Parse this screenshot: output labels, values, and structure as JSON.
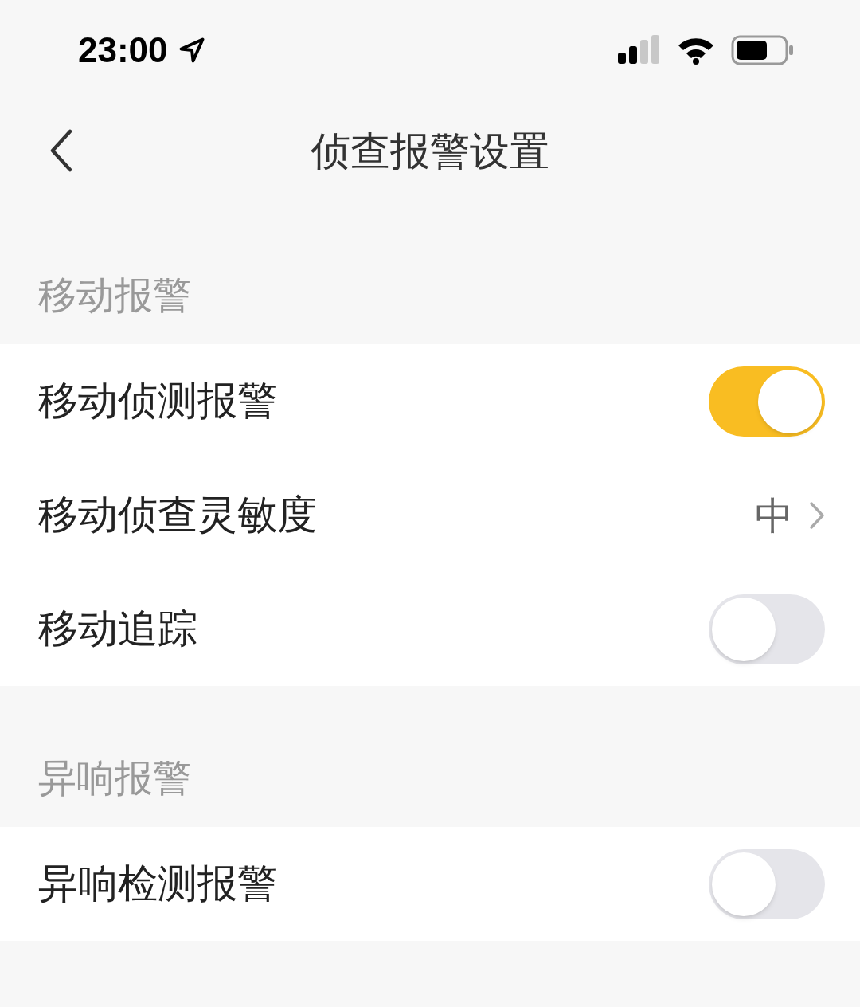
{
  "status_bar": {
    "time": "23:00"
  },
  "nav": {
    "title": "侦查报警设置"
  },
  "sections": [
    {
      "title": "移动报警",
      "rows": [
        {
          "kind": "toggle",
          "label": "移动侦测报警",
          "on": true
        },
        {
          "kind": "value",
          "label": "移动侦查灵敏度",
          "value": "中"
        },
        {
          "kind": "toggle",
          "label": "移动追踪",
          "on": false
        }
      ]
    },
    {
      "title": "异响报警",
      "rows": [
        {
          "kind": "toggle",
          "label": "异响检测报警",
          "on": false
        }
      ]
    }
  ]
}
